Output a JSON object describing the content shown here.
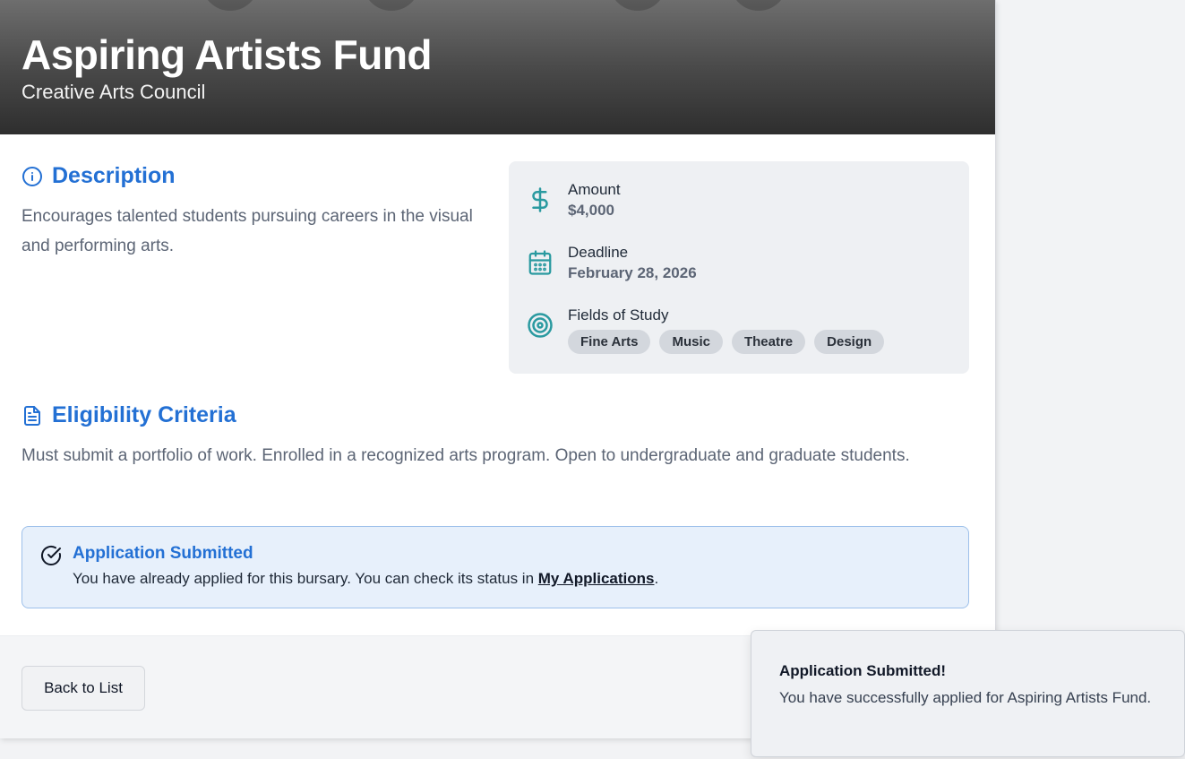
{
  "header": {
    "title": "Aspiring Artists Fund",
    "subtitle": "Creative Arts Council"
  },
  "description": {
    "heading": "Description",
    "text": "Encourages talented students pursuing careers in the visual and performing arts."
  },
  "details": {
    "amount_label": "Amount",
    "amount_value": "$4,000",
    "deadline_label": "Deadline",
    "deadline_value": "February 28, 2026",
    "fields_label": "Fields of Study",
    "fields": [
      "Fine Arts",
      "Music",
      "Theatre",
      "Design"
    ]
  },
  "eligibility": {
    "heading": "Eligibility Criteria",
    "text": "Must submit a portfolio of work. Enrolled in a recognized arts program. Open to undergraduate and graduate students."
  },
  "alert": {
    "title": "Application Submitted",
    "text_before": "You have already applied for this bursary. You can check its status in ",
    "link": "My Applications",
    "text_after": "."
  },
  "footer": {
    "back_label": "Back to List"
  },
  "toast": {
    "title": "Application Submitted!",
    "text": "You have successfully applied for Aspiring Artists Fund."
  },
  "colors": {
    "accent": "#2370d4",
    "icon_teal": "#2a9aa0",
    "alert_bg": "#e7f0fb"
  },
  "icons": {
    "description": "info-icon",
    "amount": "dollar-icon",
    "deadline": "calendar-icon",
    "fields": "target-icon",
    "eligibility": "document-icon",
    "alert": "check-circle-icon"
  }
}
